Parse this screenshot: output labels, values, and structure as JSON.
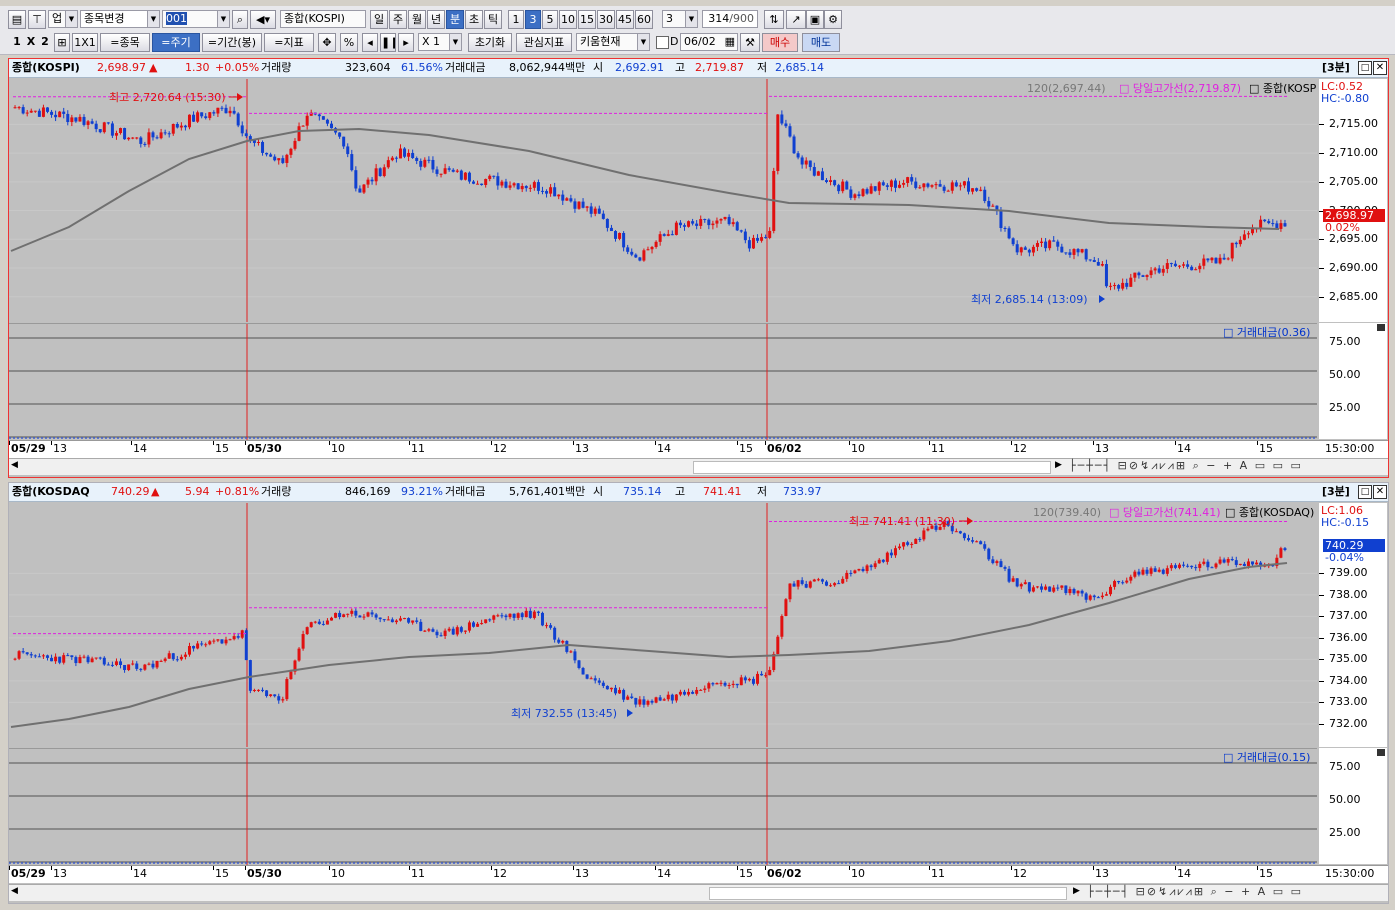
{
  "toolbar1": {
    "market": "업",
    "change_code_label": "종목변경",
    "code": "001",
    "stock_name": "종합(KOSPI)",
    "periods": [
      "일",
      "주",
      "월",
      "년",
      "분",
      "초",
      "틱"
    ],
    "active_period": "분",
    "intervals": [
      "1",
      "3",
      "5",
      "10",
      "15",
      "30",
      "45",
      "60"
    ],
    "active_interval": "3",
    "interval_value": "3",
    "count": "314",
    "max_count": "/900"
  },
  "toolbar2": {
    "layouts": [
      "1",
      "X",
      "2"
    ],
    "layout_1x1": "1X1",
    "btn_stock": "=종목",
    "btn_period": "=주기",
    "btn_range": "=기간(봉)",
    "btn_indicator": "=지표",
    "pct": "%",
    "zoom": "X 1",
    "reset": "초기화",
    "interest": "관심지표",
    "kiwoom": "키움현재",
    "date_label": "D",
    "date": "06/02",
    "buy": "매수",
    "sell": "매도"
  },
  "kospi": {
    "name": "종합(KOSPI)",
    "price": "2,698.97",
    "arrow": "▲",
    "change": "1.30",
    "change_pct": "+0.05%",
    "volume_label": "거래량",
    "volume": "323,604",
    "volume_ratio": "61.56%",
    "amount_label": "거래대금",
    "amount": "8,062,944백만",
    "open_label": "시",
    "open": "2,692.91",
    "high_label": "고",
    "high": "2,719.87",
    "low_label": "저",
    "low": "2,685.14",
    "timeframe": "[3분]",
    "ma_legend": "120(2,697.44)",
    "highline_legend": "당일고가선(2,719.87)",
    "series_legend": "종합(KOSPI)",
    "lc": "LC:0.52",
    "hc": "HC:-0.80",
    "price_tag": "2,698.97",
    "price_tag_pct": "0.02%",
    "high_annotation": "최고 2,720.64 (15:30)",
    "low_annotation": "최저 2,685.14 (13:09)",
    "sub_legend": "거래대금(0.36)",
    "y_ticks": [
      "2,715.00",
      "2,710.00",
      "2,705.00",
      "2,700.00",
      "2,695.00",
      "2,690.00",
      "2,685.00"
    ],
    "sub_ticks": [
      "75.00",
      "50.00",
      "25.00"
    ]
  },
  "kosdaq": {
    "name": "종합(KOSDAQ",
    "price": "740.29",
    "arrow": "▲",
    "change": "5.94",
    "change_pct": "+0.81%",
    "volume_label": "거래량",
    "volume": "846,169",
    "volume_ratio": "93.21%",
    "amount_label": "거래대금",
    "amount": "5,761,401백만",
    "open_label": "시",
    "open": "735.14",
    "high_label": "고",
    "high": "741.41",
    "low_label": "저",
    "low": "733.97",
    "timeframe": "[3분]",
    "ma_legend": "120(739.40)",
    "highline_legend": "당일고가선(741.41)",
    "series_legend": "종합(KOSDAQ)",
    "lc": "LC:1.06",
    "hc": "HC:-0.15",
    "price_tag": "740.29",
    "price_tag_pct": "-0.04%",
    "high_annotation": "최고 741.41 (11:30)",
    "low_annotation": "최저 732.55 (13:45)",
    "sub_legend": "거래대금(0.15)",
    "y_ticks": [
      "739.00",
      "738.00",
      "737.00",
      "736.00",
      "735.00",
      "734.00",
      "733.00",
      "732.00"
    ],
    "sub_ticks": [
      "75.00",
      "50.00",
      "25.00"
    ]
  },
  "x_axis": {
    "labels": [
      "05/29",
      "13",
      "14",
      "15",
      "05/30",
      "10",
      "11",
      "12",
      "13",
      "14",
      "15",
      "06/02",
      "10",
      "11",
      "12",
      "13",
      "14",
      "15"
    ],
    "end_time": "15:30:00"
  },
  "colors": {
    "up": "#e01010",
    "down": "#1040d0",
    "ma": "#707070",
    "highline": "#e020e0",
    "grid": "#ffffff"
  },
  "icons": [
    "chart-layout-icon",
    "pin-icon",
    "search-icon",
    "speaker-icon",
    "crosshair-icon",
    "prev-icon",
    "pause-icon",
    "next-icon",
    "calendar-icon",
    "save-icon",
    "settings-icon"
  ]
}
